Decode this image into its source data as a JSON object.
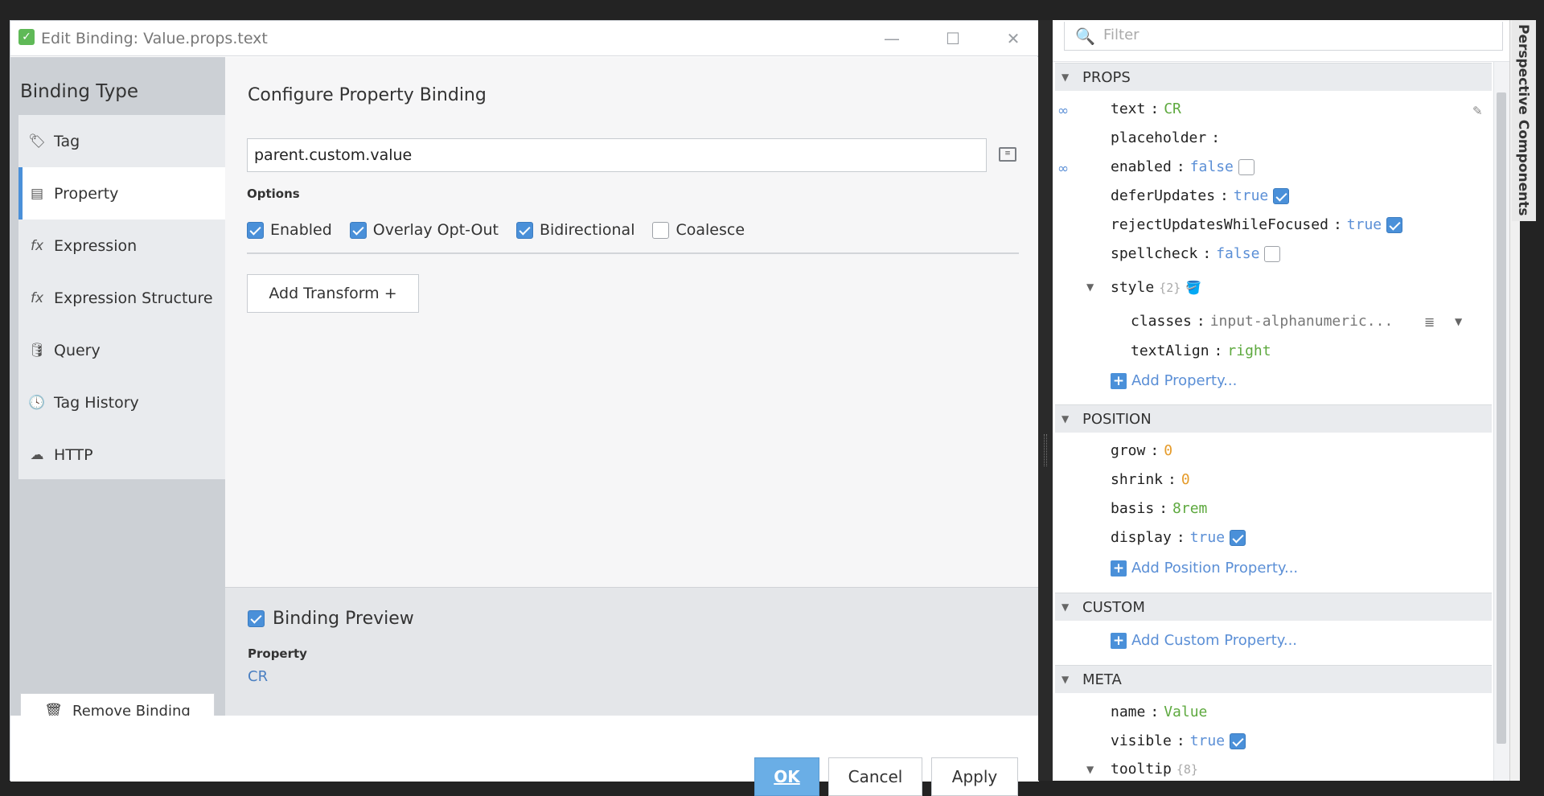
{
  "dialog": {
    "title": "Edit Binding: Value.props.text",
    "app_icon": "check-app-icon",
    "min_glyph": "—",
    "max_glyph": "☐",
    "close_glyph": "✕"
  },
  "left": {
    "heading": "Binding Type",
    "items": [
      {
        "label": "Tag",
        "icon": "🏷"
      },
      {
        "label": "Property",
        "icon": "▤"
      },
      {
        "label": "Expression",
        "icon": "fx"
      },
      {
        "label": "Expression Structure",
        "icon": "fx"
      },
      {
        "label": "Query",
        "icon": "🛢"
      },
      {
        "label": "Tag History",
        "icon": "🕓"
      },
      {
        "label": "HTTP",
        "icon": "☁"
      }
    ],
    "selected": "Property",
    "remove_label": "Remove Binding"
  },
  "config": {
    "title": "Configure Property Binding",
    "path_value": "parent.custom.value",
    "options_label": "Options",
    "options": [
      {
        "label": "Enabled",
        "checked": true
      },
      {
        "label": "Overlay Opt-Out",
        "checked": true
      },
      {
        "label": "Bidirectional",
        "checked": true
      },
      {
        "label": "Coalesce",
        "checked": false
      }
    ],
    "transform_label": "Add Transform +"
  },
  "preview": {
    "label": "Binding Preview",
    "checked": true,
    "prop_label": "Property",
    "value": "CR"
  },
  "footer": {
    "ok": "OK",
    "cancel": "Cancel",
    "apply": "Apply"
  },
  "right": {
    "filter_placeholder": "Filter",
    "side_tab": "Perspective Components",
    "sections": {
      "props": "PROPS",
      "position": "POSITION",
      "custom": "CUSTOM",
      "meta": "META"
    },
    "props": [
      {
        "key": "text",
        "value": "CR",
        "kind": "green",
        "linked": true
      },
      {
        "key": "placeholder",
        "value": "",
        "kind": "none",
        "linked": false
      },
      {
        "key": "enabled",
        "value": "false",
        "kind": "blue",
        "check": false,
        "linked": true
      },
      {
        "key": "deferUpdates",
        "value": "true",
        "kind": "blue",
        "check": true
      },
      {
        "key": "rejectUpdatesWhileFocused",
        "value": "true",
        "kind": "blue",
        "check": true
      },
      {
        "key": "spellcheck",
        "value": "false",
        "kind": "blue",
        "check": false
      }
    ],
    "style": {
      "key": "style",
      "count": "{2}"
    },
    "style_children": [
      {
        "key": "classes",
        "value": "input-alphanumeric..."
      },
      {
        "key": "textAlign",
        "value": "right"
      }
    ],
    "add_property": "Add Property...",
    "position_props": [
      {
        "key": "grow",
        "value": "0",
        "kind": "orange"
      },
      {
        "key": "shrink",
        "value": "0",
        "kind": "orange"
      },
      {
        "key": "basis",
        "value": "8rem",
        "kind": "green"
      },
      {
        "key": "display",
        "value": "true",
        "kind": "blue",
        "check": true
      }
    ],
    "add_position": "Add Position Property...",
    "add_custom": "Add Custom Property...",
    "meta_props": [
      {
        "key": "name",
        "value": "Value",
        "kind": "green"
      },
      {
        "key": "visible",
        "value": "true",
        "kind": "blue",
        "check": true
      }
    ],
    "tooltip": {
      "key": "tooltip",
      "count": "{8}"
    }
  }
}
